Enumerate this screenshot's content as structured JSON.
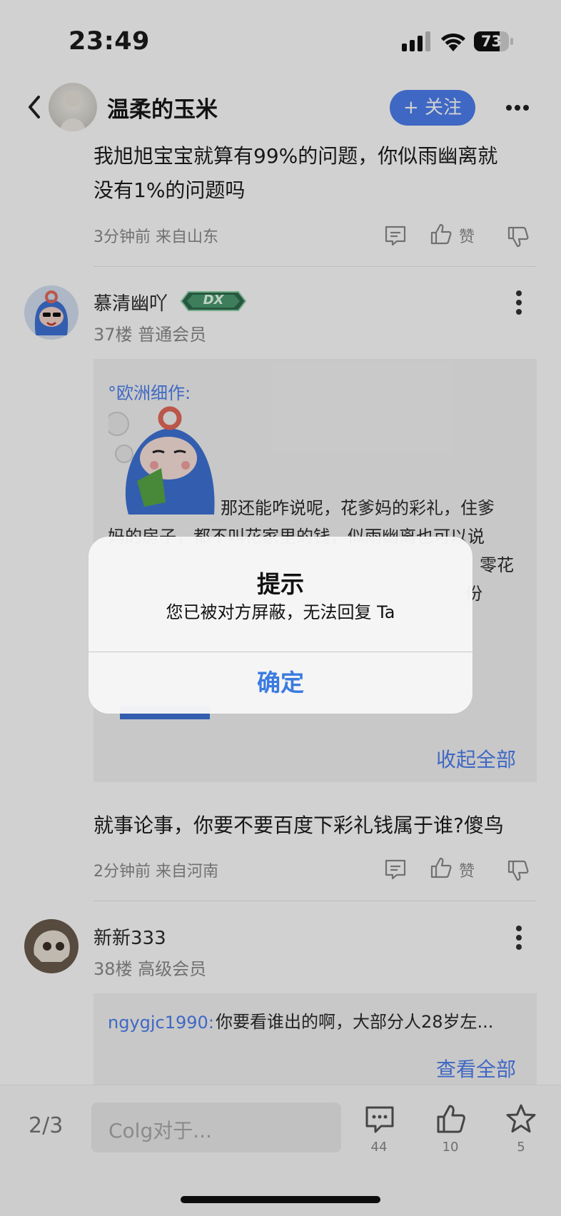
{
  "status_bar": {
    "time": "23:49",
    "battery": "73",
    "battery_level": 0.73
  },
  "header": {
    "username": "温柔的玉米",
    "follow_label": "+ 关注"
  },
  "post1": {
    "text_line1": "我旭旭宝宝就算有99%的问题，你似雨幽离就",
    "text_line2": "没有1%的问题吗",
    "meta": "3分钟前 来自山东",
    "like_label": "赞"
  },
  "reply37": {
    "username": "慕清幽吖",
    "floor": "37楼 普通会员",
    "badge_text": "DX",
    "quote_user": "°欧洲细作:",
    "quote_line1": "那还能咋说呢，花爹妈的彩礼，住爹",
    "quote_line2": "妈的房子，都不叫花家里的钱，似雨幽离也可以说",
    "quote_line3": "零花",
    "quote_line4": "份",
    "collapse_label": "收起全部",
    "text": "就事论事，你要不要百度下彩礼钱属于谁?傻鸟",
    "meta": "2分钟前 来自河南",
    "like_label": "赞"
  },
  "reply38": {
    "username": "新新333",
    "floor": "38楼 高级会员",
    "quote_user": "ngygjc1990:",
    "quote_text": "你要看谁出的啊，大部分人28岁左...",
    "view_all_label": "查看全部"
  },
  "bottom_bar": {
    "page": "2/3",
    "input_placeholder": "Colg对于...",
    "comment_count": "44",
    "like_count": "10",
    "fav_count": "5"
  },
  "alert": {
    "title": "提示",
    "message": "您已被对方屏蔽，无法回复 Ta",
    "confirm_label": "确定"
  },
  "colors": {
    "accent": "#4e7ff0",
    "alert_button": "#3b7be0"
  }
}
